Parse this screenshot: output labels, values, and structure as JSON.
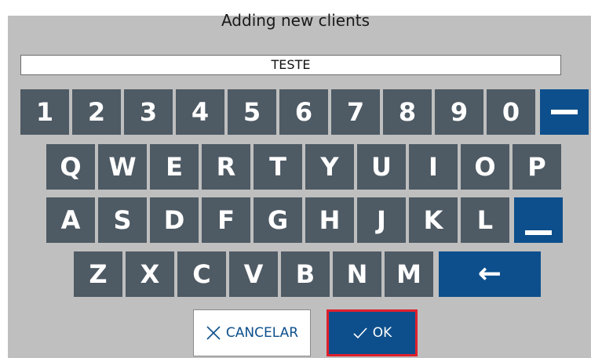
{
  "dialog": {
    "title": "Adding new clients",
    "input_value": "TESTE"
  },
  "keyboard": {
    "row1": [
      "1",
      "2",
      "3",
      "4",
      "5",
      "6",
      "7",
      "8",
      "9",
      "0"
    ],
    "row2": [
      "Q",
      "W",
      "E",
      "R",
      "T",
      "Y",
      "U",
      "I",
      "O",
      "P"
    ],
    "row3": [
      "A",
      "S",
      "D",
      "F",
      "G",
      "H",
      "J",
      "K",
      "L"
    ],
    "row4": [
      "Z",
      "X",
      "C",
      "V",
      "B",
      "N",
      "M"
    ],
    "special": {
      "minus": "minus-key",
      "underscore": "underscore-key",
      "backspace": "←"
    }
  },
  "actions": {
    "cancel_label": "CANCELAR",
    "ok_label": "OK"
  },
  "colors": {
    "key_gray": "#4e5a64",
    "key_blue": "#0d4f8c",
    "panel_bg": "#bfbfbf",
    "ok_highlight": "#e0202c"
  }
}
